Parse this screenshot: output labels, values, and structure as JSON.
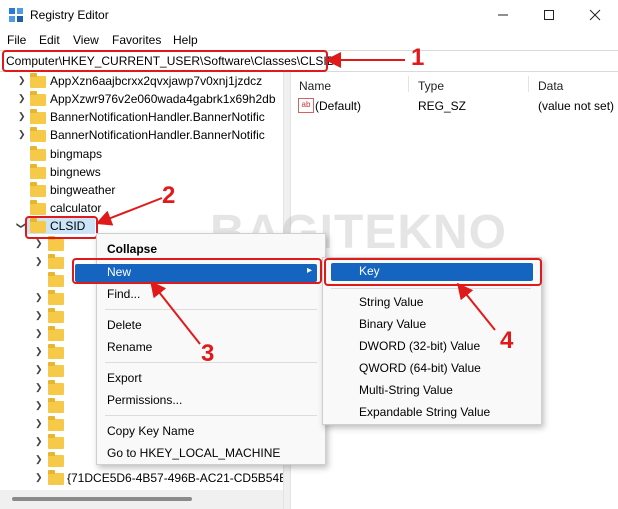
{
  "window": {
    "title": "Registry Editor"
  },
  "menubar": [
    "File",
    "Edit",
    "View",
    "Favorites",
    "Help"
  ],
  "address": "Computer\\HKEY_CURRENT_USER\\Software\\Classes\\CLSID",
  "tree": {
    "items": [
      "AppXzn6aajbcrxx2qvxjawp7v0xnj1jzdcz",
      "AppXzwr976v2e060wada4gabrk1x69h2db",
      "BannerNotificationHandler.BannerNotific",
      "BannerNotificationHandler.BannerNotific",
      "bingmaps",
      "bingnews",
      "bingweather",
      "calculator",
      "CLSID"
    ],
    "bottom_item": "{71DCE5D6-4B57-496B-AC21-CD5B54E"
  },
  "values": {
    "columns": [
      "Name",
      "Type",
      "Data"
    ],
    "rows": [
      {
        "name": "(Default)",
        "type": "REG_SZ",
        "data": "(value not set)"
      }
    ]
  },
  "context_menu": {
    "items": [
      "Collapse",
      "New",
      "Find...",
      "Delete",
      "Rename",
      "Export",
      "Permissions...",
      "Copy Key Name",
      "Go to HKEY_LOCAL_MACHINE"
    ]
  },
  "submenu": {
    "items": [
      "Key",
      "String Value",
      "Binary Value",
      "DWORD (32-bit) Value",
      "QWORD (64-bit) Value",
      "Multi-String Value",
      "Expandable String Value"
    ]
  },
  "annotations": [
    "1",
    "2",
    "3",
    "4"
  ],
  "watermark": "BAGITEKNO",
  "colors": {
    "annotation": "#e01a1a",
    "highlight": "#1565c0",
    "folder": "#f7c948"
  }
}
